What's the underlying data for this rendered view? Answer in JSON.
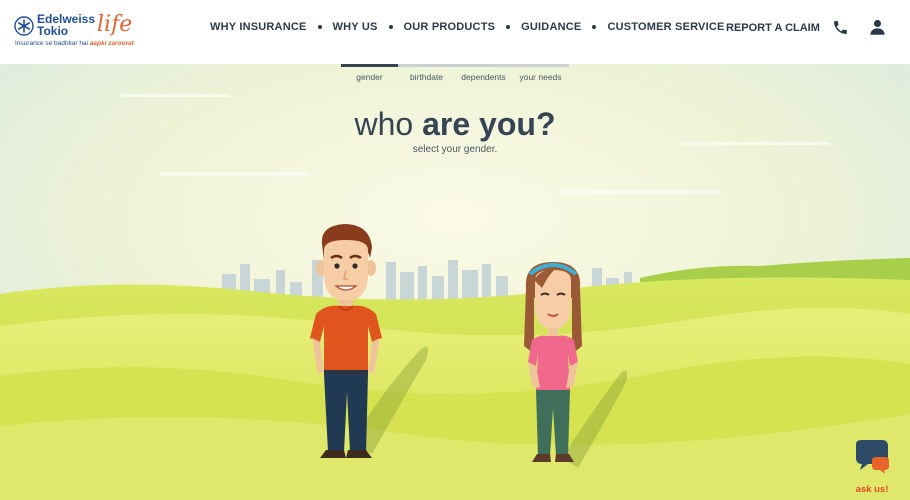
{
  "logo": {
    "name_line1": "Edelweiss",
    "name_line2": "Tokio",
    "script": "life",
    "tagline_prefix": "Insurance se badhkar hai",
    "tagline_emphasis": "aapki zaroorat"
  },
  "nav": {
    "items": [
      "WHY INSURANCE",
      "WHY US",
      "OUR PRODUCTS",
      "GUIDANCE",
      "CUSTOMER SERVICE"
    ]
  },
  "header_actions": {
    "report_claim": "REPORT A CLAIM",
    "phone_icon": "phone-icon",
    "user_icon": "user-icon"
  },
  "steps": [
    {
      "label": "gender",
      "active": true
    },
    {
      "label": "birthdate",
      "active": false
    },
    {
      "label": "dependents",
      "active": false
    },
    {
      "label": "your needs",
      "active": false
    }
  ],
  "heading": {
    "light": "who ",
    "bold": "are you?",
    "subtitle": "select your gender."
  },
  "characters": {
    "male_icon": "male-character",
    "female_icon": "female-character"
  },
  "chat": {
    "label": "ask us!",
    "icon": "chat-bubbles-icon"
  },
  "colors": {
    "brand_blue": "#1e4f9c",
    "brand_orange": "#e8632a",
    "text_dark": "#354555",
    "ask_red": "#e8492a"
  }
}
